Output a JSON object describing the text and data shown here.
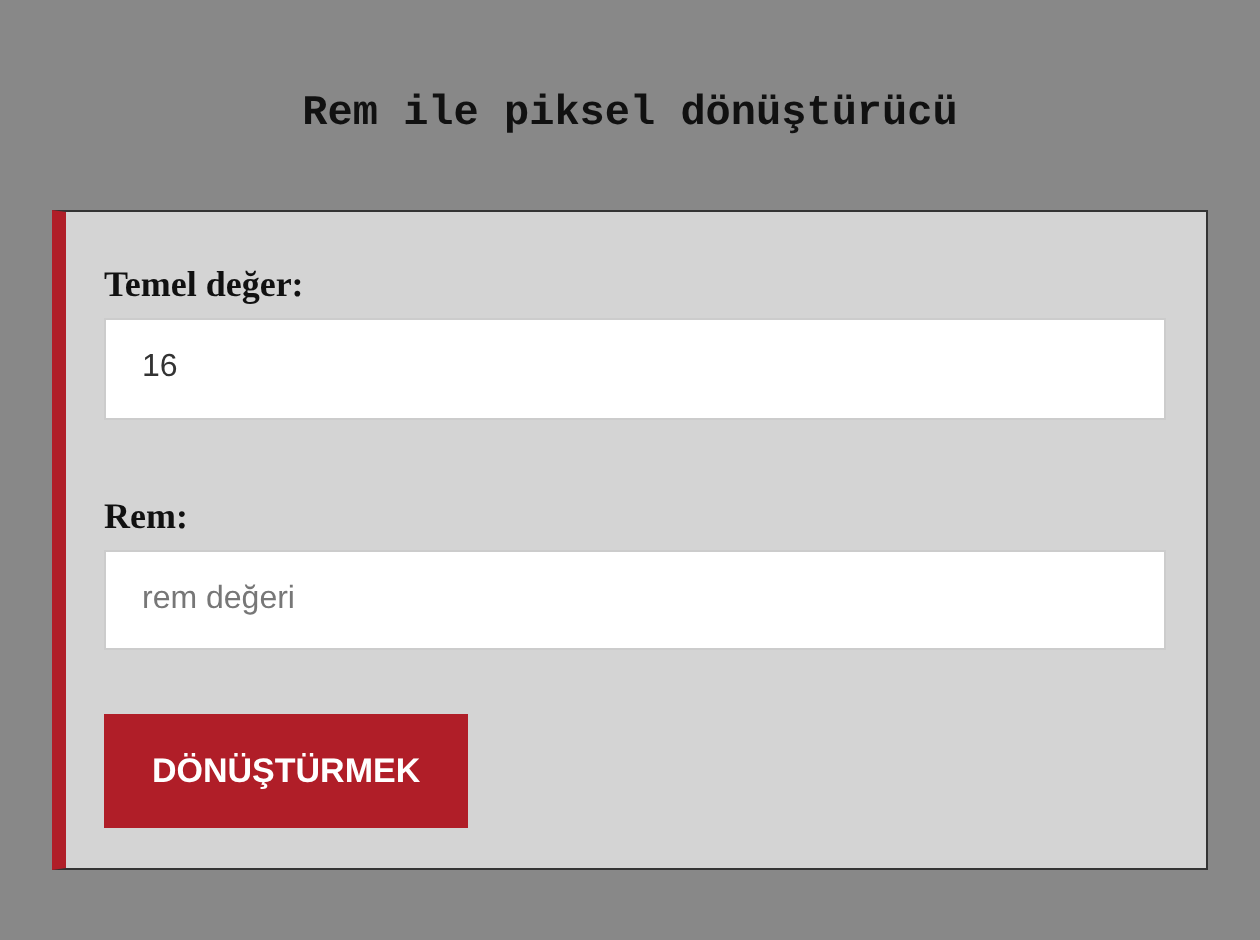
{
  "title": "Rem ile piksel dönüştürücü",
  "fields": [
    {
      "label": "Temel değer:",
      "value": "16"
    },
    {
      "label": "Rem:",
      "placeholder": "rem değeri"
    }
  ],
  "button": "DÖNÜŞTÜRMEK"
}
